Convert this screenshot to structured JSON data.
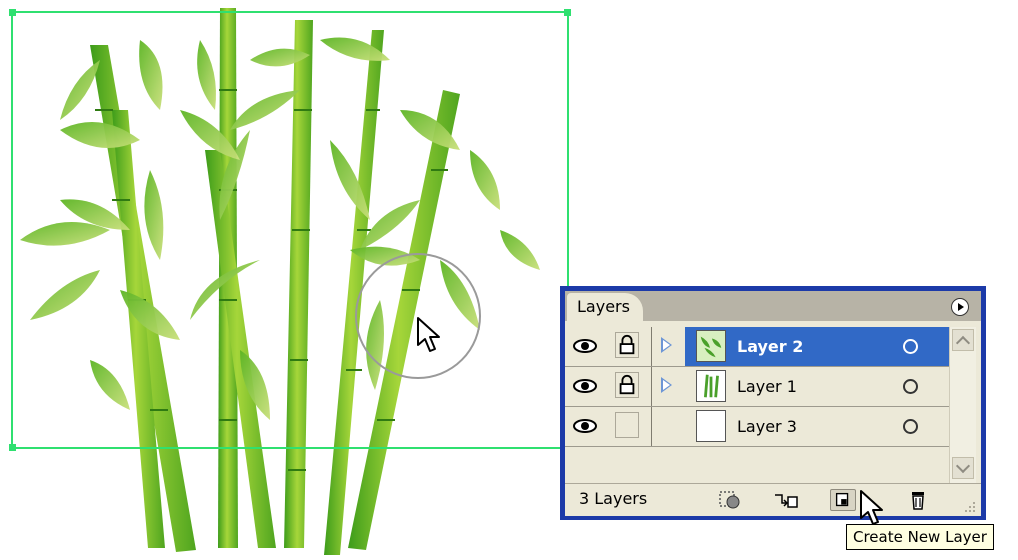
{
  "panel": {
    "tab_label": "Layers",
    "layers": [
      {
        "name": "Layer 2",
        "selected": true,
        "locked": true,
        "visible": true,
        "expandable": true
      },
      {
        "name": "Layer 1",
        "selected": false,
        "locked": true,
        "visible": true,
        "expandable": true
      },
      {
        "name": "Layer 3",
        "selected": false,
        "locked": false,
        "visible": true,
        "expandable": false
      }
    ],
    "layer_count": "3 Layers",
    "tooltip": "Create New Layer",
    "icons": {
      "visibility": "eye-icon",
      "lock": "lock-icon",
      "expand": "triangle-right-icon",
      "target": "circle-target-icon",
      "menu": "panel-menu-icon",
      "mask": "clipping-mask-icon",
      "sublayer": "new-sublayer-icon",
      "new_layer": "new-layer-icon",
      "delete": "trash-icon"
    }
  },
  "colors": {
    "panel_border": "#1c3aa8",
    "selection": "#3169c6",
    "panel_bg": "#ece9d8",
    "bounding_box": "#2fe070",
    "bamboo_dark": "#3d9c1a",
    "bamboo_light": "#a6d63a",
    "tooltip_bg": "#ffffe1"
  }
}
